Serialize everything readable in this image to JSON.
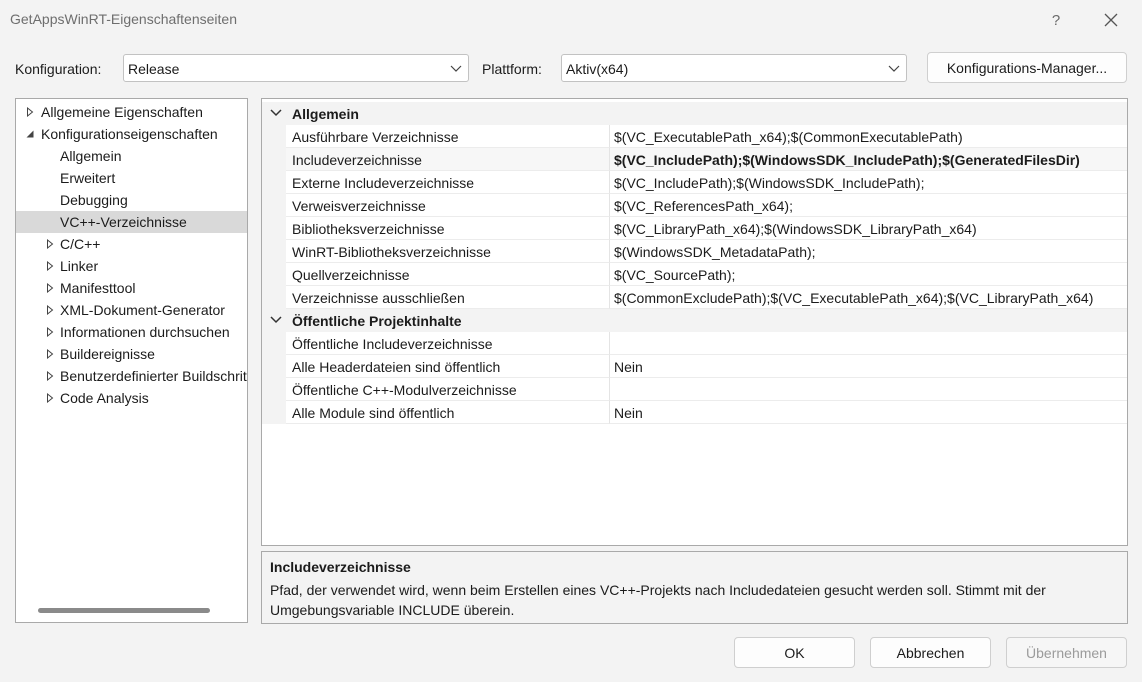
{
  "window": {
    "title": "GetAppsWinRT-Eigenschaftenseiten",
    "help_label": "?"
  },
  "config_row": {
    "konfiguration_label": "Konfiguration:",
    "konfiguration_value": "Release",
    "plattform_label": "Plattform:",
    "plattform_value": "Aktiv(x64)",
    "manager_button": "Konfigurations-Manager..."
  },
  "tree": {
    "items": [
      {
        "label": "Allgemeine Eigenschaften",
        "expander": "collapsed"
      },
      {
        "label": "Konfigurationseigenschaften",
        "expander": "expanded"
      },
      {
        "label": "Allgemein",
        "expander": "none"
      },
      {
        "label": "Erweitert",
        "expander": "none"
      },
      {
        "label": "Debugging",
        "expander": "none"
      },
      {
        "label": "VC++-Verzeichnisse",
        "expander": "none",
        "selected": true
      },
      {
        "label": "C/C++",
        "expander": "collapsed"
      },
      {
        "label": "Linker",
        "expander": "collapsed"
      },
      {
        "label": "Manifesttool",
        "expander": "collapsed"
      },
      {
        "label": "XML-Dokument-Generator",
        "expander": "collapsed"
      },
      {
        "label": "Informationen durchsuchen",
        "expander": "collapsed"
      },
      {
        "label": "Buildereignisse",
        "expander": "collapsed"
      },
      {
        "label": "Benutzerdefinierter Buildschritt",
        "expander": "collapsed"
      },
      {
        "label": "Code Analysis",
        "expander": "collapsed"
      }
    ]
  },
  "grid": {
    "categories": [
      {
        "label": "Allgemein",
        "rows": [
          {
            "name": "Ausführbare Verzeichnisse",
            "value": "$(VC_ExecutablePath_x64);$(CommonExecutablePath)"
          },
          {
            "name": "Includeverzeichnisse",
            "value": "$(VC_IncludePath);$(WindowsSDK_IncludePath);$(GeneratedFilesDir)",
            "bold": true,
            "selected": true
          },
          {
            "name": "Externe Includeverzeichnisse",
            "value": "$(VC_IncludePath);$(WindowsSDK_IncludePath);"
          },
          {
            "name": "Verweisverzeichnisse",
            "value": "$(VC_ReferencesPath_x64);"
          },
          {
            "name": "Bibliotheksverzeichnisse",
            "value": "$(VC_LibraryPath_x64);$(WindowsSDK_LibraryPath_x64)"
          },
          {
            "name": "WinRT-Bibliotheksverzeichnisse",
            "value": "$(WindowsSDK_MetadataPath);"
          },
          {
            "name": "Quellverzeichnisse",
            "value": "$(VC_SourcePath);"
          },
          {
            "name": "Verzeichnisse ausschließen",
            "value": "$(CommonExcludePath);$(VC_ExecutablePath_x64);$(VC_LibraryPath_x64)"
          }
        ]
      },
      {
        "label": "Öffentliche Projektinhalte",
        "rows": [
          {
            "name": "Öffentliche Includeverzeichnisse",
            "value": ""
          },
          {
            "name": "Alle Headerdateien sind öffentlich",
            "value": "Nein"
          },
          {
            "name": "Öffentliche C++-Modulverzeichnisse",
            "value": ""
          },
          {
            "name": "Alle Module sind öffentlich",
            "value": "Nein"
          }
        ]
      }
    ]
  },
  "description": {
    "title": "Includeverzeichnisse",
    "text": "Pfad, der verwendet wird, wenn beim Erstellen eines VC++-Projekts nach Includedateien gesucht werden soll.  Stimmt mit der Umgebungsvariable INCLUDE überein."
  },
  "buttons": {
    "ok": "OK",
    "cancel": "Abbrechen",
    "apply": "Übernehmen"
  }
}
